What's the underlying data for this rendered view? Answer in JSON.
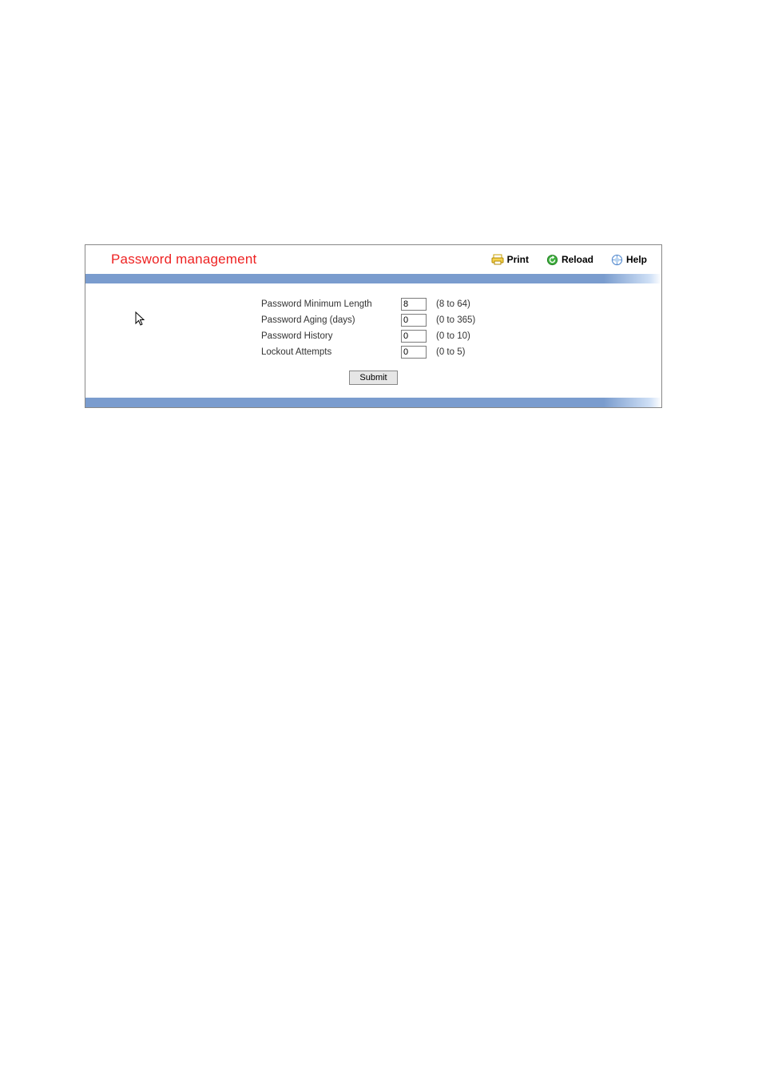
{
  "header": {
    "title": "Password management"
  },
  "toolbar": {
    "print_label": "Print",
    "reload_label": "Reload",
    "help_label": "Help"
  },
  "form": {
    "rows": [
      {
        "label": "Password Minimum Length",
        "value": "8",
        "range": "(8 to 64)"
      },
      {
        "label": "Password Aging (days)",
        "value": "0",
        "range": "(0 to 365)"
      },
      {
        "label": "Password History",
        "value": "0",
        "range": "(0 to 10)"
      },
      {
        "label": "Lockout Attempts",
        "value": "0",
        "range": "(0 to 5)"
      }
    ],
    "submit_label": "Submit"
  }
}
